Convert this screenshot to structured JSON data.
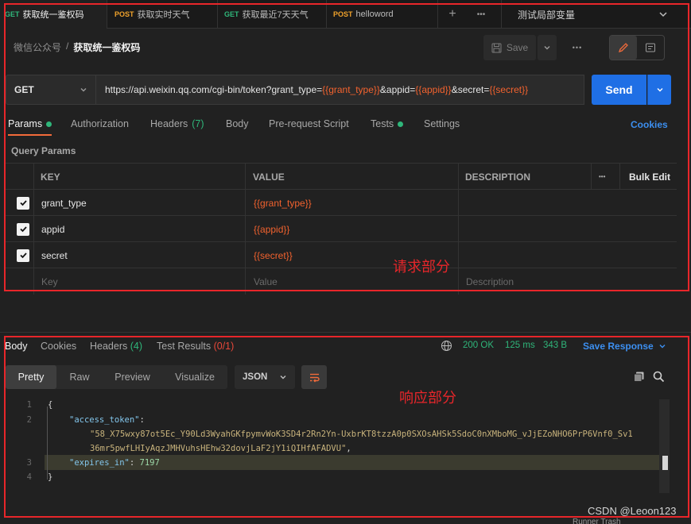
{
  "tabs": [
    {
      "method": "GET",
      "name": "获取统一鉴权码",
      "active": true
    },
    {
      "method": "POST",
      "name": "获取实时天气",
      "active": false
    },
    {
      "method": "GET",
      "name": "获取最近7天天气",
      "active": false
    },
    {
      "method": "POST",
      "name": "helloword",
      "active": false
    }
  ],
  "tab_controls": {
    "new": "+",
    "more": "•••"
  },
  "environment": {
    "label": "测试局部变量"
  },
  "breadcrumb": {
    "collection": "微信公众号",
    "separator": "/",
    "request": "获取统一鉴权码"
  },
  "toolbar": {
    "save_label": "Save",
    "more": "•••"
  },
  "request": {
    "method": "GET",
    "url_prefix": "https://api.weixin.qq.com/cgi-bin/token?grant_type=",
    "var1": "{{grant_type}}",
    "mid1": "&appid=",
    "var2": "{{appid}}",
    "mid2": "&secret=",
    "var3": "{{secret}}",
    "send_label": "Send"
  },
  "request_tabs": {
    "params": "Params",
    "authorization": "Authorization",
    "headers": "Headers",
    "headers_count": "(7)",
    "body": "Body",
    "prerequest": "Pre-request Script",
    "tests": "Tests",
    "settings": "Settings",
    "cookies": "Cookies"
  },
  "query_params": {
    "title": "Query Params",
    "columns": {
      "key": "KEY",
      "value": "VALUE",
      "description": "DESCRIPTION",
      "more": "•••",
      "bulk": "Bulk Edit"
    },
    "rows": [
      {
        "key": "grant_type",
        "value": "{{grant_type}}",
        "checked": true
      },
      {
        "key": "appid",
        "value": "{{appid}}",
        "checked": true
      },
      {
        "key": "secret",
        "value": "{{secret}}",
        "checked": true
      }
    ],
    "placeholders": {
      "key": "Key",
      "value": "Value",
      "description": "Description"
    }
  },
  "annotations": {
    "request": "请求部分",
    "response": "响应部分"
  },
  "response_tabs": {
    "body": "Body",
    "cookies": "Cookies",
    "headers": "Headers",
    "headers_count": "(4)",
    "tests": "Test Results",
    "tests_count": "(0/1)"
  },
  "response_status": {
    "status": "200 OK",
    "time": "125 ms",
    "size": "343 B",
    "save": "Save Response"
  },
  "format_tabs": [
    "Pretty",
    "Raw",
    "Preview",
    "Visualize"
  ],
  "format_select": "JSON",
  "response_body": {
    "lines": [
      "1",
      "2",
      "3",
      "4"
    ],
    "open_brace": "{",
    "close_brace": "}",
    "key1": "\"access_token\"",
    "token_part1": "\"58_X75wxy87ot5Ec_Y90Ld3WyahGKfpymvWoK3SD4r2Rn2Yn-UxbrKT8tzzA0p0SXOsAHSk5SdoC0nXMboMG_vJjEZoNHO6PrP6Vnf0_Sv1",
    "token_part2": "36mr5pwfLHIyAqzJMHVuhsHEhw32dovjLaF2jY1iQIHfAFADVU\"",
    "key2": "\"expires_in\"",
    "value2": "7197"
  },
  "watermark": "CSDN @Leoon123",
  "footer": "Runner   Trash",
  "colors": {
    "accent": "#f26b3a",
    "send": "#1f6fe5",
    "variable": "#f2622e",
    "success": "#2fb67a",
    "annotation_box": "#e8262a"
  }
}
